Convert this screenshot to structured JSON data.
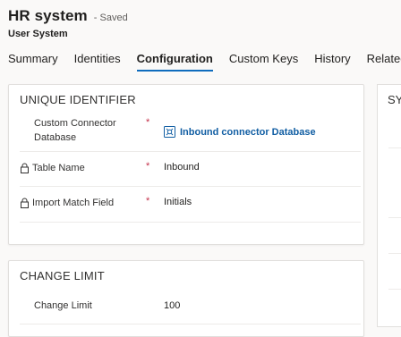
{
  "header": {
    "title": "HR system",
    "status": "- Saved",
    "subtitle": "User System"
  },
  "tabs": [
    {
      "label": "Summary"
    },
    {
      "label": "Identities"
    },
    {
      "label": "Configuration"
    },
    {
      "label": "Custom Keys"
    },
    {
      "label": "History"
    },
    {
      "label": "Related"
    }
  ],
  "unique_identifier": {
    "title": "UNIQUE IDENTIFIER",
    "fields": [
      {
        "label": "Custom Connector Database",
        "required": "*",
        "value": "Inbound connector Database"
      },
      {
        "label": "Table Name",
        "required": "*",
        "value": "Inbound"
      },
      {
        "label": "Import Match Field",
        "required": "*",
        "value": "Initials"
      }
    ]
  },
  "change_limit": {
    "title": "CHANGE LIMIT",
    "fields": [
      {
        "label": "Change Limit",
        "value": "100"
      }
    ]
  },
  "right_panel": {
    "title": "SY"
  },
  "colors": {
    "accent": "#0f6cbd",
    "link": "#115ea3",
    "required": "#c4314b"
  }
}
